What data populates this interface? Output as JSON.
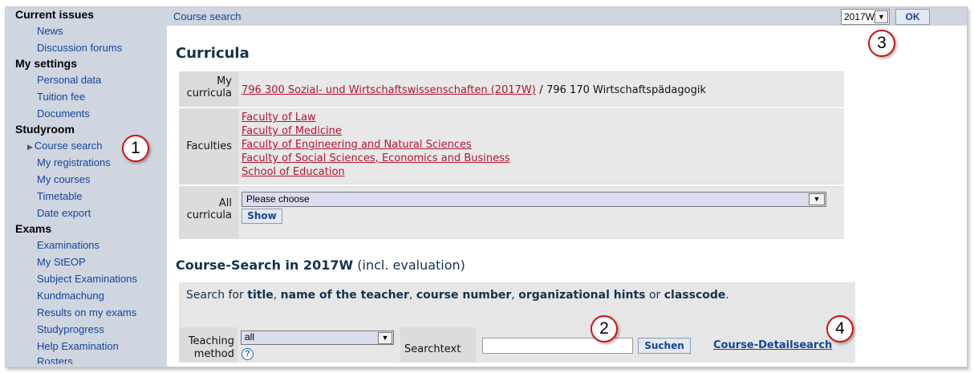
{
  "sidebar": {
    "sections": [
      {
        "title": "Current issues",
        "items": [
          "News",
          "Discussion forums"
        ]
      },
      {
        "title": "My settings",
        "items": [
          "Personal data",
          "Tuition fee",
          "Documents"
        ]
      },
      {
        "title": "Studyroom",
        "items": [
          "Course search",
          "My registrations",
          "My courses",
          "Timetable",
          "Date export"
        ]
      },
      {
        "title": "Exams",
        "items": [
          "Examinations",
          "My StEOP",
          "Subject Examinations",
          "Kundmachung",
          "Results on my exams",
          "Studyprogress",
          "Help Examination",
          "Rosters"
        ]
      }
    ],
    "active_item": "Course search"
  },
  "topbar": {
    "breadcrumb": "Course search",
    "semester_value": "2017W",
    "ok_label": "OK"
  },
  "curricula": {
    "heading": "Curricula",
    "my_label_1": "My",
    "my_label_2": "curricula",
    "my_link": "796 300 Sozial- und Wirtschaftswissenschaften (2017W)",
    "separator": "/",
    "my_second": "796 170 Wirtschaftspädagogik",
    "faculties_label": "Faculties",
    "faculties": [
      "Faculty of Law",
      "Faculty of Medicine",
      "Faculty of Engineering and Natural Sciences",
      "Faculty of Social Sciences, Economics and Business",
      "School of Education"
    ],
    "all_label_1": "All",
    "all_label_2": "curricula",
    "select_value": "Please choose",
    "show_label": "Show"
  },
  "course_search": {
    "heading_bold": "Course-Search in 2017W",
    "heading_suffix": "(incl. evaluation)",
    "hint": {
      "prefix": "Search for",
      "t1": "title",
      "t2": "name of the teacher",
      "t3": "course number",
      "t4": "organizational hints",
      "or": "or",
      "t5": "classcode"
    },
    "teaching_label_1": "Teaching",
    "teaching_label_2": "method",
    "teaching_value": "all",
    "help_glyph": "?",
    "searchtext_label": "Searchtext",
    "search_value": "",
    "suchen_label": "Suchen",
    "detail_link": "Course-Detailsearch"
  },
  "callouts": [
    "1",
    "2",
    "3",
    "4"
  ],
  "icons": {
    "active_arrow": "triangle-right-icon",
    "dropdown": "chevron-down-icon",
    "help": "help-icon"
  },
  "colors": {
    "sidebar_bg": "#cfd6e0",
    "link_blue": "#14439b",
    "link_red": "#b5152f",
    "callout_red": "#d01010"
  }
}
